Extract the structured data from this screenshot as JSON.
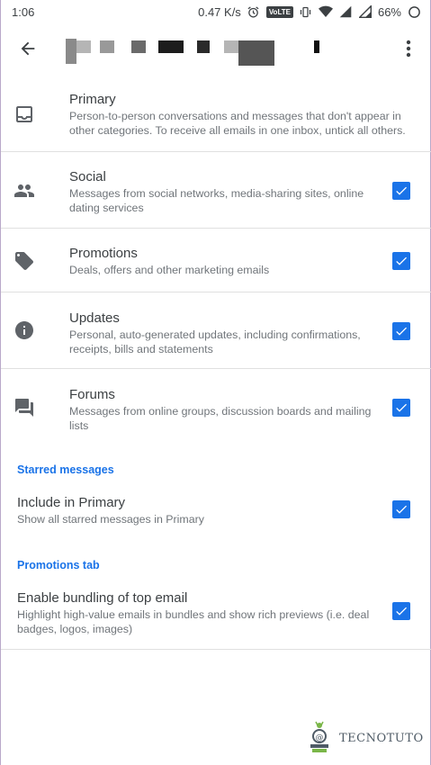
{
  "status_bar": {
    "time": "1:06",
    "net_speed": "0.47 K/s",
    "volte": "VoLTE",
    "battery": "66%"
  },
  "categories": [
    {
      "title": "Primary",
      "description": "Person-to-person conversations and messages that don't appear in other categories. To receive all emails in one inbox, untick all others.",
      "icon": "inbox-icon",
      "checked": null
    },
    {
      "title": "Social",
      "description": "Messages from social networks, media-sharing sites, online dating services",
      "icon": "people-icon",
      "checked": true
    },
    {
      "title": "Promotions",
      "description": "Deals, offers and other marketing emails",
      "icon": "tag-icon",
      "checked": true
    },
    {
      "title": "Updates",
      "description": "Personal, auto-generated updates, including confirmations, receipts, bills and statements",
      "icon": "info-icon",
      "checked": true
    },
    {
      "title": "Forums",
      "description": "Messages from online groups, discussion boards and mailing lists",
      "icon": "forum-icon",
      "checked": true
    }
  ],
  "starred": {
    "heading": "Starred messages",
    "title": "Include in Primary",
    "description": "Show all starred messages in Primary",
    "checked": true
  },
  "promotions_tab": {
    "heading": "Promotions tab",
    "title": "Enable bundling of top email",
    "description": "Highlight high-value emails in bundles and show rich previews (i.e. deal badges, logos, images)",
    "checked": true
  },
  "watermark": {
    "text": "TECNOTUTO"
  },
  "colors": {
    "accent": "#1a73e8",
    "icon": "#5f6368"
  }
}
